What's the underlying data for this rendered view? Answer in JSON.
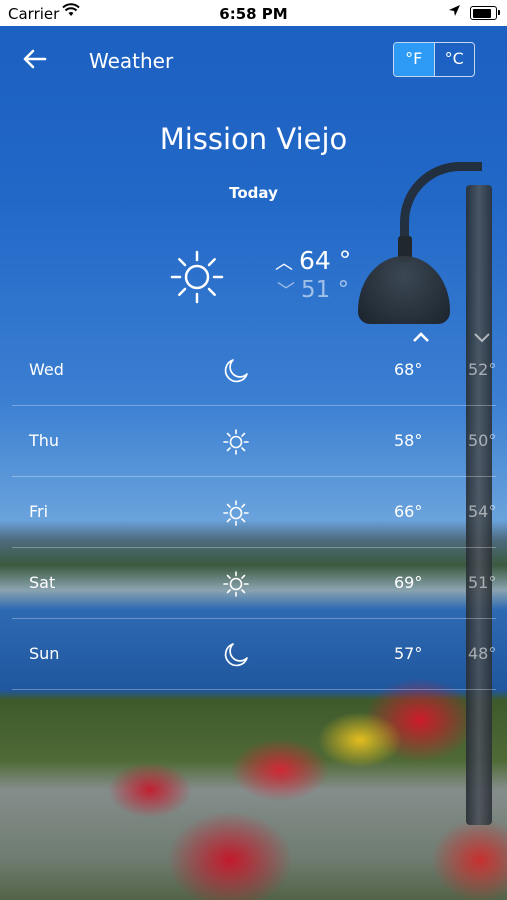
{
  "status_bar": {
    "carrier": "Carrier",
    "time": "6:58 PM",
    "battery_level": 0.85
  },
  "header": {
    "title": "Weather",
    "unit_f": "°F",
    "unit_c": "°C",
    "selected_unit": "°F"
  },
  "location": {
    "city": "Mission Viejo"
  },
  "today": {
    "label": "Today",
    "icon": "sun-icon",
    "high": "64 °",
    "low": "51 °"
  },
  "forecast": [
    {
      "day": "Wed",
      "icon": "moon-icon",
      "high": "68°",
      "low": "52°"
    },
    {
      "day": "Thu",
      "icon": "sun-icon",
      "high": "58°",
      "low": "50°"
    },
    {
      "day": "Fri",
      "icon": "sun-icon",
      "high": "66°",
      "low": "54°"
    },
    {
      "day": "Sat",
      "icon": "sun-icon",
      "high": "69°",
      "low": "51°"
    },
    {
      "day": "Sun",
      "icon": "moon-icon",
      "high": "57°",
      "low": "48°"
    }
  ],
  "colors": {
    "accent": "#2d9af5",
    "background": "#1b59b5"
  }
}
